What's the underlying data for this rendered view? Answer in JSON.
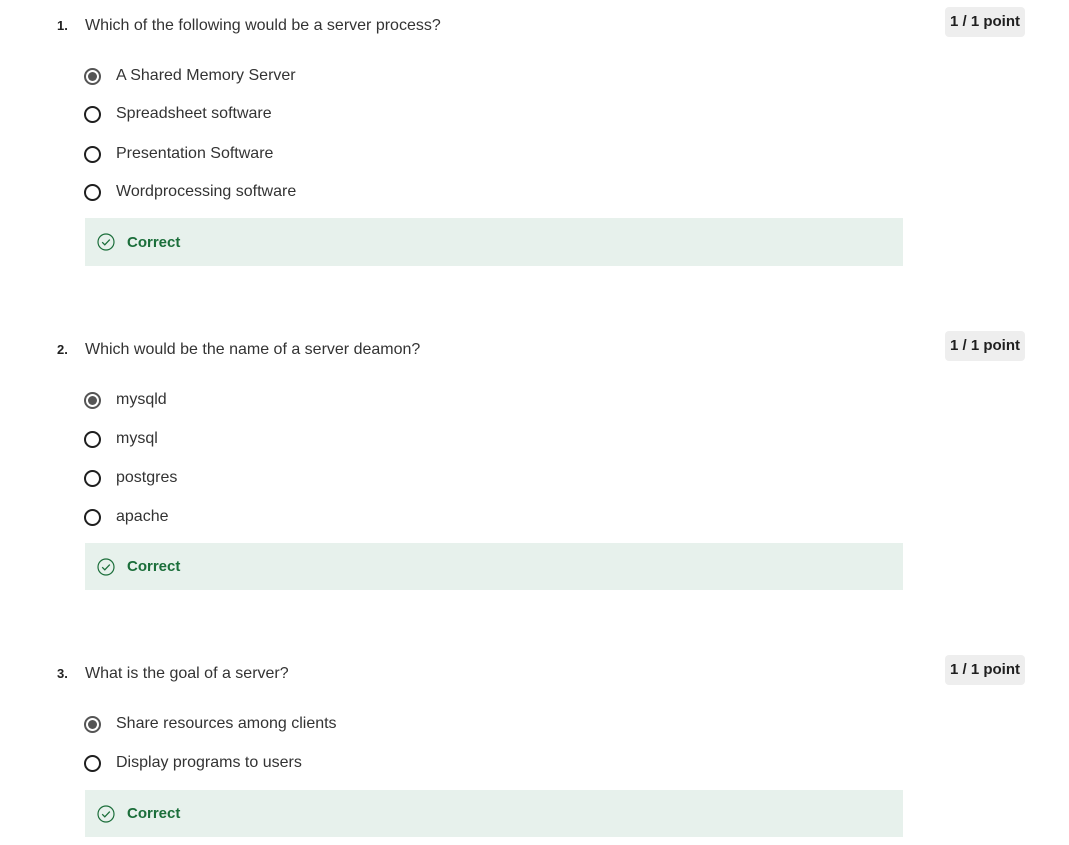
{
  "questions": [
    {
      "number": "1.",
      "text": "Which of the following would be a server process?",
      "score": "1 / 1 point",
      "options": [
        {
          "label": "A Shared Memory Server",
          "selected": true
        },
        {
          "label": "Spreadsheet software",
          "selected": false
        },
        {
          "label": "Presentation Software",
          "selected": false
        },
        {
          "label": "Wordprocessing software",
          "selected": false
        }
      ],
      "feedback": "Correct"
    },
    {
      "number": "2.",
      "text": "Which would be the name of a server deamon?",
      "score": "1 / 1 point",
      "options": [
        {
          "label": "mysqld",
          "selected": true
        },
        {
          "label": "mysql",
          "selected": false
        },
        {
          "label": "postgres",
          "selected": false
        },
        {
          "label": "apache",
          "selected": false
        }
      ],
      "feedback": "Correct"
    },
    {
      "number": "3.",
      "text": "What is the goal of a server?",
      "score": "1 / 1 point",
      "options": [
        {
          "label": "Share resources among clients",
          "selected": true
        },
        {
          "label": "Display programs to users",
          "selected": false
        }
      ],
      "feedback": "Correct"
    }
  ],
  "colors": {
    "feedback_bg": "#e7f1ec",
    "correct_text": "#1b6e3a",
    "score_bg": "#eeeeee"
  },
  "icons": {
    "selected": "radio-selected-icon",
    "unselected": "radio-unselected-icon",
    "feedback": "check-circle-icon"
  }
}
